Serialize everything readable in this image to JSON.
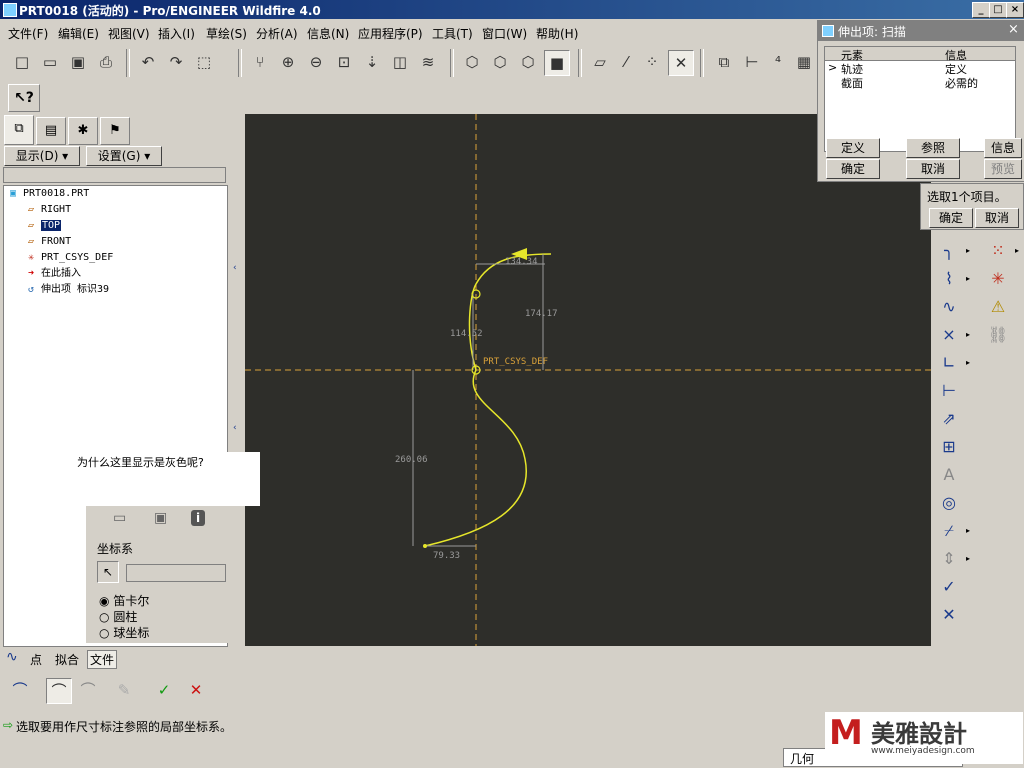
{
  "window": {
    "title": "PRT0018 (活动的) - Pro/ENGINEER Wildfire 4.0"
  },
  "menu": [
    "文件(F)",
    "编辑(E)",
    "视图(V)",
    "插入(I)",
    "草绘(S)",
    "分析(A)",
    "信息(N)",
    "应用程序(P)",
    "工具(T)",
    "窗口(W)",
    "帮助(H)"
  ],
  "nav": {
    "show_label": "显示(D) ▾",
    "settings_label": "设置(G) ▾"
  },
  "tree": {
    "items": [
      {
        "label": "PRT0018.PRT",
        "icon": "part-icon"
      },
      {
        "label": "RIGHT",
        "icon": "datum-plane-icon"
      },
      {
        "label": "TOP",
        "icon": "datum-plane-icon"
      },
      {
        "label": "FRONT",
        "icon": "datum-plane-icon"
      },
      {
        "label": "PRT_CSYS_DEF",
        "icon": "csys-icon"
      },
      {
        "label": "在此插入",
        "icon": "insert-arrow-icon"
      },
      {
        "label": "伸出项 标识39",
        "icon": "sweep-icon"
      }
    ]
  },
  "viewport": {
    "dims": {
      "d1": "134.34",
      "d2": "114.52",
      "d3": "174.17",
      "d4": "260.06",
      "d5": "79.33"
    },
    "csys_label": "PRT_CSYS_DEF",
    "curve_color": "#e6e62a",
    "axis_color": "#d9a23a",
    "dim_color": "#9a9a9a"
  },
  "dialog": {
    "title": "伸出项: 扫描",
    "columns": [
      "元素",
      "信息"
    ],
    "rows": [
      {
        "mark": ">",
        "element": "轨迹",
        "info": "定义"
      },
      {
        "mark": "",
        "element": "截面",
        "info": "必需的"
      }
    ],
    "buttons": {
      "define": "定义",
      "refs": "参照",
      "info": "信息",
      "ok": "确定",
      "cancel": "取消",
      "preview": "预览"
    }
  },
  "select_box": {
    "text": "选取1个项目。",
    "ok": "确定",
    "cancel": "取消"
  },
  "tooltip": {
    "text": "为什么这里显示是灰色呢?"
  },
  "csys_panel": {
    "label": "坐标系",
    "options": [
      "笛卡尔",
      "圆柱",
      "球坐标"
    ],
    "selected": "笛卡尔"
  },
  "dash_tabs": {
    "point": "点",
    "fit": "拟合",
    "file": "文件"
  },
  "message": "选取要用作尺寸标注参照的局部坐标系。",
  "status": {
    "filter": "几何"
  },
  "logo": {
    "text": "美雅設計",
    "url": "www.meiyadesign.com"
  }
}
